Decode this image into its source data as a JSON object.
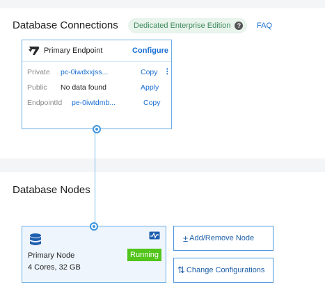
{
  "connections": {
    "title": "Database Connections",
    "edition_badge": "Dedicated Enterprise Edition",
    "faq_label": "FAQ",
    "endpoint": {
      "title": "Primary Endpoint",
      "configure_label": "Configure",
      "rows": [
        {
          "key": "Private",
          "value": "pc-0iwdxxjss...",
          "action": "Copy"
        },
        {
          "key": "Public",
          "value": "No data found",
          "action": "Apply"
        },
        {
          "key": "EndpointId",
          "value": "pe-0iwtdmb...",
          "action": "Copy"
        }
      ]
    }
  },
  "nodes": {
    "title": "Database Nodes",
    "primary": {
      "name": "Primary Node",
      "spec": "4 Cores, 32 GB",
      "status": "Running"
    },
    "actions": {
      "add_remove_label": "Add/Remove Node",
      "change_label": "Change Configurations"
    }
  },
  "colors": {
    "accent": "#1a6fd3",
    "card_border": "#6aaee6",
    "status_running": "#52c41a",
    "badge_bg": "#e8f4ec"
  },
  "icons": {
    "endpoint_logo": "endpoint-logo-icon",
    "help": "help-circle-icon",
    "more": "more-vertical-icon",
    "database": "database-icon",
    "monitor": "monitor-chart-icon",
    "add_remove": "plus-minus-icon",
    "change": "swap-vertical-icon"
  }
}
